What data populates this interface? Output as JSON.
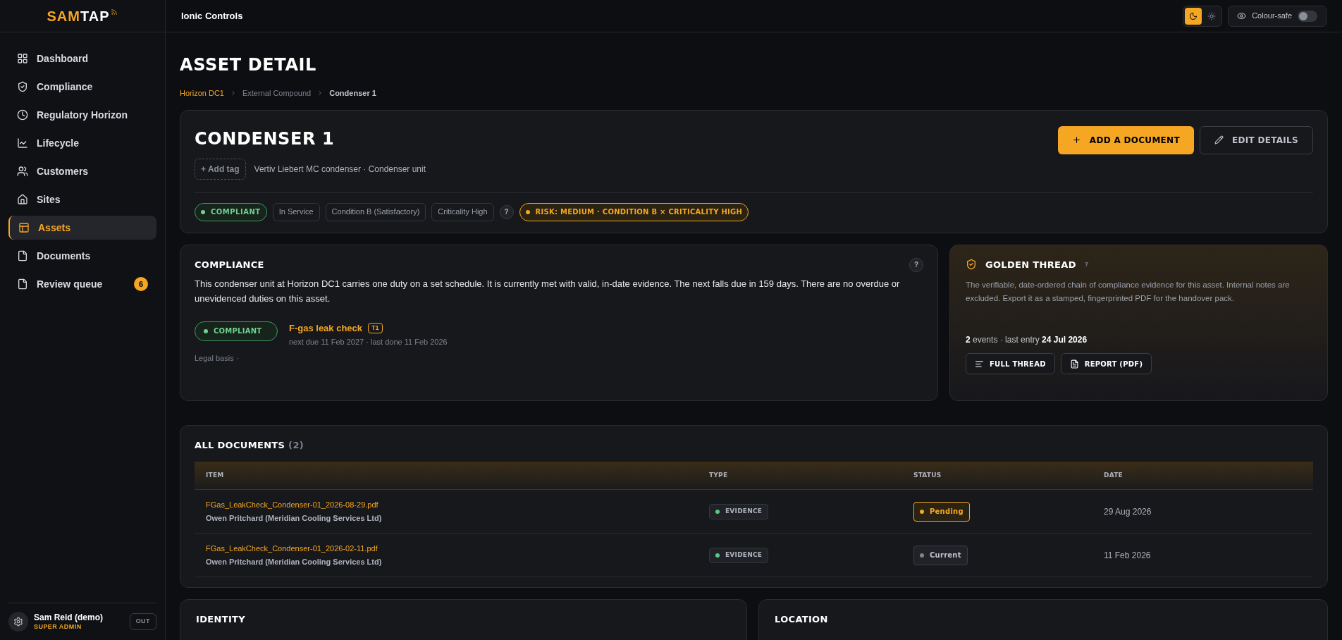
{
  "brand": {
    "primary": "SAM",
    "secondary": "TAP"
  },
  "sidebar": {
    "items": [
      {
        "label": "Dashboard",
        "selected": false
      },
      {
        "label": "Compliance",
        "selected": false
      },
      {
        "label": "Regulatory Horizon",
        "selected": false
      },
      {
        "label": "Lifecycle",
        "selected": false
      },
      {
        "label": "Customers",
        "selected": false
      },
      {
        "label": "Sites",
        "selected": false
      },
      {
        "label": "Assets",
        "selected": true
      },
      {
        "label": "Documents",
        "selected": false
      },
      {
        "label": "Review queue",
        "selected": false,
        "badge": "6"
      }
    ]
  },
  "user": {
    "name": "Sam Reid (demo)",
    "role": "SUPER ADMIN",
    "logout": "OUT"
  },
  "topbar": {
    "org": "Ionic Controls",
    "theme": [
      {
        "selected": true
      },
      {
        "selected": false
      }
    ],
    "colour_safe": {
      "label": "Colour-safe",
      "on": false
    }
  },
  "page": {
    "title": "ASSET DETAIL",
    "breadcrumb": [
      "Horizon DC1",
      "External Compound",
      "Condenser 1"
    ]
  },
  "asset": {
    "name": "CONDENSER 1",
    "add_tag": "+ Add tag",
    "description": "Vertiv Liebert MC condenser · Condenser unit",
    "actions": [
      {
        "label": "ADD A DOCUMENT",
        "kind": "primary"
      },
      {
        "label": "EDIT DETAILS",
        "kind": "secondary"
      }
    ],
    "chips": [
      {
        "label": "COMPLIANT",
        "kind": "status"
      },
      {
        "label": "In Service",
        "kind": "plain"
      },
      {
        "label": "Condition B (Satisfactory)",
        "kind": "plain"
      },
      {
        "label": "Criticality High",
        "kind": "plain"
      },
      {
        "label": "?",
        "kind": "help"
      },
      {
        "label": "RISK: MEDIUM · CONDITION B × CRITICALITY HIGH",
        "kind": "risk"
      }
    ]
  },
  "compliance": {
    "title": "COMPLIANCE",
    "help": "?",
    "summary": "This condenser unit at Horizon DC1 carries one duty on a set schedule. It is currently met with valid, in-date evidence. The next falls due in 159 days. There are no overdue or unevidenced duties on this asset.",
    "duties": [
      {
        "status": "COMPLIANT",
        "name": "F-gas leak check",
        "tier": "T1",
        "dates": "next due 11 Feb 2027 · last done 11 Feb 2026",
        "legal": "Legal basis ·"
      }
    ]
  },
  "golden_thread": {
    "title": "GOLDEN THREAD",
    "help": "?",
    "text": "The verifiable, date-ordered chain of compliance evidence for this asset. Internal notes are excluded. Export it as a stamped, fingerprinted PDF for the handover pack.",
    "stats": "**2** events · last entry **24 Jul 2026**",
    "buttons": [
      {
        "label": "FULL THREAD"
      },
      {
        "label": "REPORT (PDF)"
      }
    ]
  },
  "documents": {
    "title": "ALL DOCUMENTS",
    "count": "(2)",
    "columns": [
      "ITEM",
      "TYPE",
      "STATUS",
      "DATE"
    ],
    "rows": [
      {
        "file": "FGas_LeakCheck_Condenser-01_2026-08-29.pdf",
        "author": "Owen Pritchard (Meridian Cooling Services Ltd)",
        "type": "EVIDENCE",
        "status": "Pending",
        "kind": "pending",
        "date": "29 Aug 2026"
      },
      {
        "file": "FGas_LeakCheck_Condenser-01_2026-02-11.pdf",
        "author": "Owen Pritchard (Meridian Cooling Services Ltd)",
        "type": "EVIDENCE",
        "status": "Current",
        "kind": "current",
        "date": "11 Feb 2026"
      }
    ]
  },
  "lower_cards": [
    {
      "title": "IDENTITY"
    },
    {
      "title": "LOCATION"
    }
  ]
}
